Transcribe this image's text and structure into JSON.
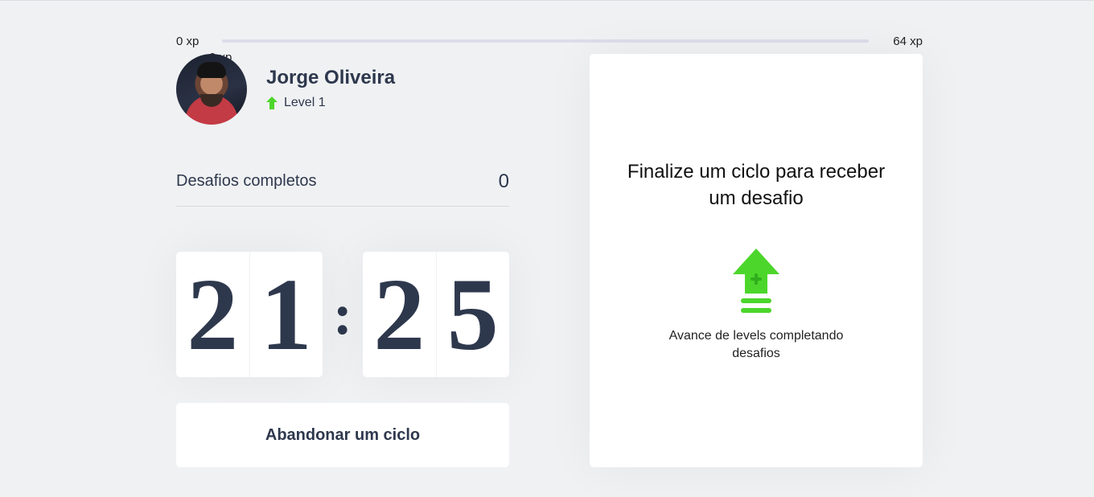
{
  "xp": {
    "start_label": "0 xp",
    "end_label": "64 xp",
    "current_label": "0 xp",
    "progress_percent": 0
  },
  "profile": {
    "name": "Jorge Oliveira",
    "level_label": "Level 1"
  },
  "challenges": {
    "completed_label": "Desafios completos",
    "completed_value": "0"
  },
  "countdown": {
    "minute_left": "2",
    "minute_right": "1",
    "separator": ":",
    "second_left": "2",
    "second_right": "5"
  },
  "abandon_button_label": "Abandonar um ciclo",
  "challenge_box": {
    "title": "Finalize um ciclo para receber um desafio",
    "hint": "Avance de levels completando desafios",
    "icon": "level-up-icon"
  },
  "colors": {
    "accent_green": "#4cd62b",
    "text_title": "#2e384d",
    "background": "#f0f1f3",
    "card": "#ffffff"
  }
}
